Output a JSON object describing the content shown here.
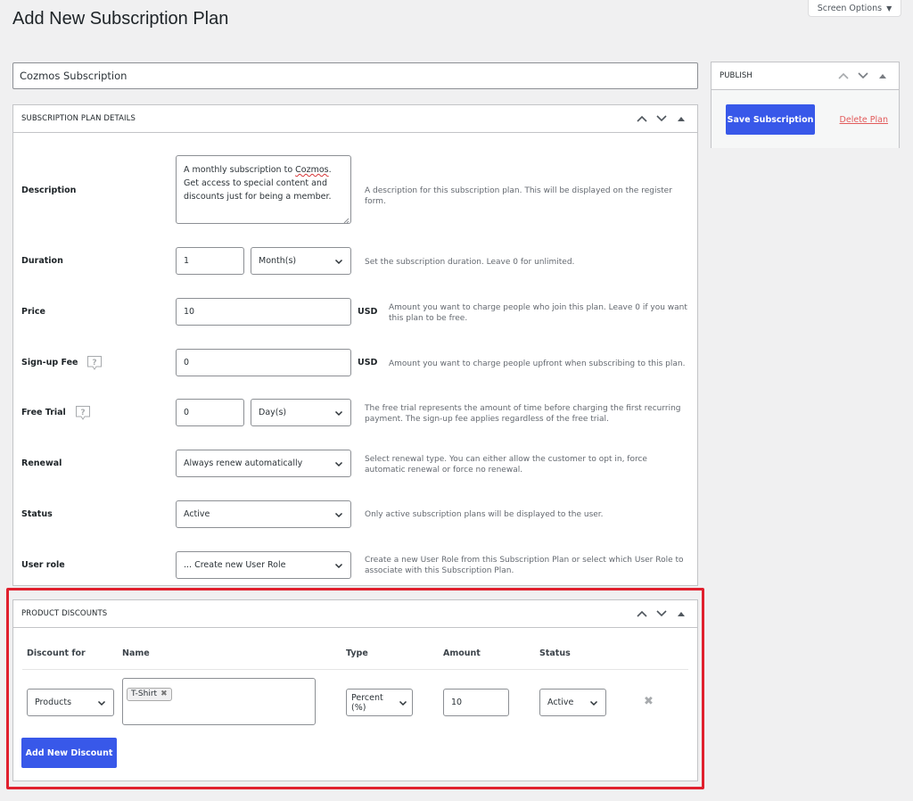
{
  "page": {
    "title": "Add New Subscription Plan",
    "screen_options_label": "Screen Options"
  },
  "title_input": {
    "value": "Cozmos Subscription"
  },
  "publish": {
    "header": "PUBLISH",
    "save_label": "Save Subscription",
    "delete_label": "Delete Plan"
  },
  "details": {
    "header": "SUBSCRIPTION PLAN DETAILS",
    "description": {
      "label": "Description",
      "value_pre": "A monthly subscription to ",
      "value_misspelled": "Cozmos",
      "value_post": ". Get access to special content and discounts just for being a member.",
      "help": "A description for this subscription plan. This will be displayed on the register form."
    },
    "duration": {
      "label": "Duration",
      "value": "1",
      "unit": "Month(s)",
      "help": "Set the subscription duration. Leave 0 for unlimited."
    },
    "price": {
      "label": "Price",
      "value": "10",
      "currency": "USD",
      "help": "Amount you want to charge people who join this plan. Leave 0 if you want this plan to be free."
    },
    "signup_fee": {
      "label": "Sign-up Fee",
      "value": "0",
      "currency": "USD",
      "help": "Amount you want to charge people upfront when subscribing to this plan."
    },
    "free_trial": {
      "label": "Free Trial",
      "value": "0",
      "unit": "Day(s)",
      "help": "The free trial represents the amount of time before charging the first recurring payment. The sign-up fee applies regardless of the free trial."
    },
    "renewal": {
      "label": "Renewal",
      "value": "Always renew automatically",
      "help": "Select renewal type. You can either allow the customer to opt in, force automatic renewal or force no renewal."
    },
    "status": {
      "label": "Status",
      "value": "Active",
      "help": "Only active subscription plans will be displayed to the user."
    },
    "user_role": {
      "label": "User role",
      "value": "... Create new User Role",
      "help": "Create a new User Role from this Subscription Plan or select which User Role to associate with this Subscription Plan."
    }
  },
  "discounts": {
    "header": "PRODUCT DISCOUNTS",
    "columns": [
      "Discount for",
      "Name",
      "Type",
      "Amount",
      "Status"
    ],
    "rows": [
      {
        "discount_for": "Products",
        "names": [
          "T-Shirt"
        ],
        "type": "Percent (%)",
        "amount": "10",
        "status": "Active"
      }
    ],
    "add_label": "Add New Discount"
  },
  "colors": {
    "primary": "#3858e9",
    "delete": "#e25b5b",
    "highlight": "#e0202e",
    "background": "#f0f0f1"
  }
}
